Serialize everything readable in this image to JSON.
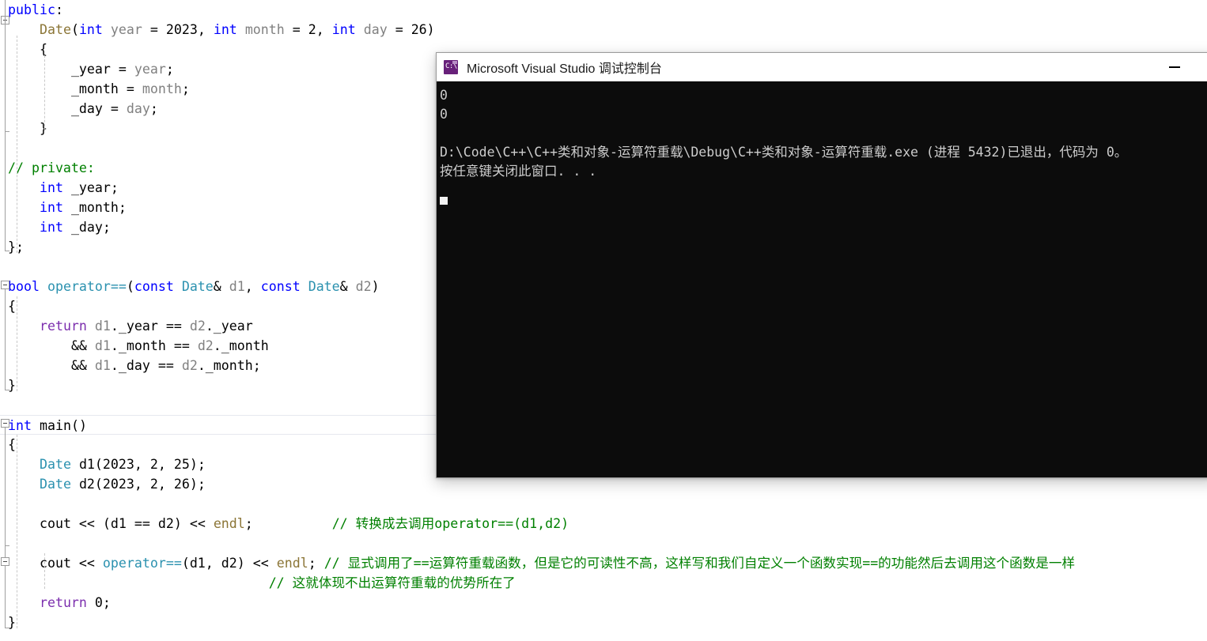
{
  "editor": {
    "lines": [
      {
        "indent": 0,
        "tokens": [
          {
            "t": "public",
            "c": "kw"
          },
          {
            "t": ":",
            "c": "pun"
          }
        ]
      },
      {
        "indent": 1,
        "tokens": [
          {
            "t": "Date",
            "c": "fn"
          },
          {
            "t": "(",
            "c": "pun"
          },
          {
            "t": "int",
            "c": "kw"
          },
          {
            "t": " ",
            "c": "txt"
          },
          {
            "t": "year",
            "c": "id"
          },
          {
            "t": " = ",
            "c": "op"
          },
          {
            "t": "2023",
            "c": "num"
          },
          {
            "t": ", ",
            "c": "pun"
          },
          {
            "t": "int",
            "c": "kw"
          },
          {
            "t": " ",
            "c": "txt"
          },
          {
            "t": "month",
            "c": "id"
          },
          {
            "t": " = ",
            "c": "op"
          },
          {
            "t": "2",
            "c": "num"
          },
          {
            "t": ", ",
            "c": "pun"
          },
          {
            "t": "int",
            "c": "kw"
          },
          {
            "t": " ",
            "c": "txt"
          },
          {
            "t": "day",
            "c": "id"
          },
          {
            "t": " = ",
            "c": "op"
          },
          {
            "t": "26",
            "c": "num"
          },
          {
            "t": ")",
            "c": "pun"
          }
        ]
      },
      {
        "indent": 1,
        "tokens": [
          {
            "t": "{",
            "c": "pun"
          }
        ]
      },
      {
        "indent": 2,
        "tokens": [
          {
            "t": "_year",
            "c": "txt"
          },
          {
            "t": " = ",
            "c": "op"
          },
          {
            "t": "year",
            "c": "id"
          },
          {
            "t": ";",
            "c": "pun"
          }
        ]
      },
      {
        "indent": 2,
        "tokens": [
          {
            "t": "_month",
            "c": "txt"
          },
          {
            "t": " = ",
            "c": "op"
          },
          {
            "t": "month",
            "c": "id"
          },
          {
            "t": ";",
            "c": "pun"
          }
        ]
      },
      {
        "indent": 2,
        "tokens": [
          {
            "t": "_day",
            "c": "txt"
          },
          {
            "t": " = ",
            "c": "op"
          },
          {
            "t": "day",
            "c": "id"
          },
          {
            "t": ";",
            "c": "pun"
          }
        ]
      },
      {
        "indent": 1,
        "tokens": [
          {
            "t": "}",
            "c": "pun"
          }
        ]
      },
      {
        "indent": 0,
        "tokens": []
      },
      {
        "indent": 0,
        "tokens": [
          {
            "t": "// private:",
            "c": "cmt"
          }
        ]
      },
      {
        "indent": 1,
        "tokens": [
          {
            "t": "int",
            "c": "kw"
          },
          {
            "t": " _year;",
            "c": "txt"
          }
        ]
      },
      {
        "indent": 1,
        "tokens": [
          {
            "t": "int",
            "c": "kw"
          },
          {
            "t": " _month;",
            "c": "txt"
          }
        ]
      },
      {
        "indent": 1,
        "tokens": [
          {
            "t": "int",
            "c": "kw"
          },
          {
            "t": " _day;",
            "c": "txt"
          }
        ]
      },
      {
        "indent": 0,
        "tokens": [
          {
            "t": "};",
            "c": "pun"
          }
        ]
      },
      {
        "indent": 0,
        "tokens": []
      },
      {
        "indent": 0,
        "tokens": [
          {
            "t": "bool",
            "c": "kw"
          },
          {
            "t": " ",
            "c": "txt"
          },
          {
            "t": "operator==",
            "c": "typ"
          },
          {
            "t": "(",
            "c": "pun"
          },
          {
            "t": "const",
            "c": "kw"
          },
          {
            "t": " ",
            "c": "txt"
          },
          {
            "t": "Date",
            "c": "typ"
          },
          {
            "t": "& ",
            "c": "pun"
          },
          {
            "t": "d1",
            "c": "id"
          },
          {
            "t": ", ",
            "c": "pun"
          },
          {
            "t": "const",
            "c": "kw"
          },
          {
            "t": " ",
            "c": "txt"
          },
          {
            "t": "Date",
            "c": "typ"
          },
          {
            "t": "& ",
            "c": "pun"
          },
          {
            "t": "d2",
            "c": "id"
          },
          {
            "t": ")",
            "c": "pun"
          }
        ]
      },
      {
        "indent": 0,
        "tokens": [
          {
            "t": "{",
            "c": "pun"
          }
        ]
      },
      {
        "indent": 1,
        "tokens": [
          {
            "t": "return",
            "c": "kw2"
          },
          {
            "t": " ",
            "c": "txt"
          },
          {
            "t": "d1",
            "c": "id"
          },
          {
            "t": "._year",
            "c": "txt"
          },
          {
            "t": " == ",
            "c": "op"
          },
          {
            "t": "d2",
            "c": "id"
          },
          {
            "t": "._year",
            "c": "txt"
          }
        ]
      },
      {
        "indent": 2,
        "tokens": [
          {
            "t": "&& ",
            "c": "op"
          },
          {
            "t": "d1",
            "c": "id"
          },
          {
            "t": "._month",
            "c": "txt"
          },
          {
            "t": " == ",
            "c": "op"
          },
          {
            "t": "d2",
            "c": "id"
          },
          {
            "t": "._month",
            "c": "txt"
          }
        ]
      },
      {
        "indent": 2,
        "tokens": [
          {
            "t": "&& ",
            "c": "op"
          },
          {
            "t": "d1",
            "c": "id"
          },
          {
            "t": "._day",
            "c": "txt"
          },
          {
            "t": " == ",
            "c": "op"
          },
          {
            "t": "d2",
            "c": "id"
          },
          {
            "t": "._month;",
            "c": "txt"
          }
        ]
      },
      {
        "indent": 0,
        "tokens": [
          {
            "t": "}",
            "c": "pun"
          }
        ]
      },
      {
        "indent": 0,
        "tokens": []
      },
      {
        "indent": 0,
        "current": true,
        "tokens": [
          {
            "t": "int",
            "c": "kw"
          },
          {
            "t": " ",
            "c": "txt"
          },
          {
            "t": "main",
            "c": "txt"
          },
          {
            "t": "()",
            "c": "pun"
          }
        ]
      },
      {
        "indent": 0,
        "tokens": [
          {
            "t": "{",
            "c": "pun"
          }
        ]
      },
      {
        "indent": 1,
        "tokens": [
          {
            "t": "Date",
            "c": "typ"
          },
          {
            "t": " ",
            "c": "txt"
          },
          {
            "t": "d1",
            "c": "txt"
          },
          {
            "t": "(",
            "c": "pun"
          },
          {
            "t": "2023",
            "c": "num"
          },
          {
            "t": ", ",
            "c": "pun"
          },
          {
            "t": "2",
            "c": "num"
          },
          {
            "t": ", ",
            "c": "pun"
          },
          {
            "t": "25",
            "c": "num"
          },
          {
            "t": ");",
            "c": "pun"
          }
        ]
      },
      {
        "indent": 1,
        "tokens": [
          {
            "t": "Date",
            "c": "typ"
          },
          {
            "t": " ",
            "c": "txt"
          },
          {
            "t": "d2",
            "c": "txt"
          },
          {
            "t": "(",
            "c": "pun"
          },
          {
            "t": "2023",
            "c": "num"
          },
          {
            "t": ", ",
            "c": "pun"
          },
          {
            "t": "2",
            "c": "num"
          },
          {
            "t": ", ",
            "c": "pun"
          },
          {
            "t": "26",
            "c": "num"
          },
          {
            "t": ");",
            "c": "pun"
          }
        ]
      },
      {
        "indent": 1,
        "tokens": []
      },
      {
        "indent": 1,
        "tokens": [
          {
            "t": "cout",
            "c": "txt"
          },
          {
            "t": " << ",
            "c": "op"
          },
          {
            "t": "(",
            "c": "pun"
          },
          {
            "t": "d1",
            "c": "txt"
          },
          {
            "t": " == ",
            "c": "op"
          },
          {
            "t": "d2",
            "c": "txt"
          },
          {
            "t": ") ",
            "c": "pun"
          },
          {
            "t": "<< ",
            "c": "op"
          },
          {
            "t": "endl",
            "c": "fn"
          },
          {
            "t": ";",
            "c": "pun"
          },
          {
            "t": "          ",
            "c": "txt"
          },
          {
            "t": "// 转换成去调用operator==(d1,d2)",
            "c": "cmt"
          }
        ]
      },
      {
        "indent": 1,
        "tokens": []
      },
      {
        "indent": 1,
        "tokens": [
          {
            "t": "cout",
            "c": "txt"
          },
          {
            "t": " << ",
            "c": "op"
          },
          {
            "t": "operator==",
            "c": "typ"
          },
          {
            "t": "(",
            "c": "pun"
          },
          {
            "t": "d1",
            "c": "txt"
          },
          {
            "t": ", ",
            "c": "pun"
          },
          {
            "t": "d2",
            "c": "txt"
          },
          {
            "t": ") ",
            "c": "pun"
          },
          {
            "t": "<< ",
            "c": "op"
          },
          {
            "t": "endl",
            "c": "fn"
          },
          {
            "t": "; ",
            "c": "pun"
          },
          {
            "t": "// 显式调用了==运算符重载函数，但是它的可读性不高，这样写和我们自定义一个函数实现==的功能然后去调用这个函数是一样",
            "c": "cmt"
          }
        ]
      },
      {
        "indent": 1,
        "tokens": [
          {
            "t": "                             ",
            "c": "txt"
          },
          {
            "t": "// 这就体现不出运算符重载的优势所在了",
            "c": "cmt"
          }
        ]
      },
      {
        "indent": 1,
        "tokens": [
          {
            "t": "return",
            "c": "kw2"
          },
          {
            "t": " ",
            "c": "txt"
          },
          {
            "t": "0",
            "c": "num"
          },
          {
            "t": ";",
            "c": "pun"
          }
        ]
      },
      {
        "indent": 0,
        "tokens": [
          {
            "t": "}",
            "c": "pun"
          }
        ]
      }
    ]
  },
  "console": {
    "title": "Microsoft Visual Studio 调试控制台",
    "icon_glyph": "C:\\",
    "minimize_label": "–",
    "output": [
      "0",
      "0",
      "",
      "D:\\Code\\C++\\C++类和对象-运算符重载\\Debug\\C++类和对象-运算符重载.exe (进程 5432)已退出，代码为 0。",
      "按任意键关闭此窗口. . ."
    ]
  },
  "colors": {
    "console_bg": "#0c0c0c",
    "console_text": "#cccccc",
    "titlebar_bg": "#ffffff",
    "icon_purple": "#68217a",
    "keyword_blue": "#0000ff",
    "type_teal": "#2b91af",
    "comment_green": "#008000",
    "return_purple": "#7c2fae",
    "identifier_gray": "#808080",
    "editor_bg": "#ffffff"
  }
}
